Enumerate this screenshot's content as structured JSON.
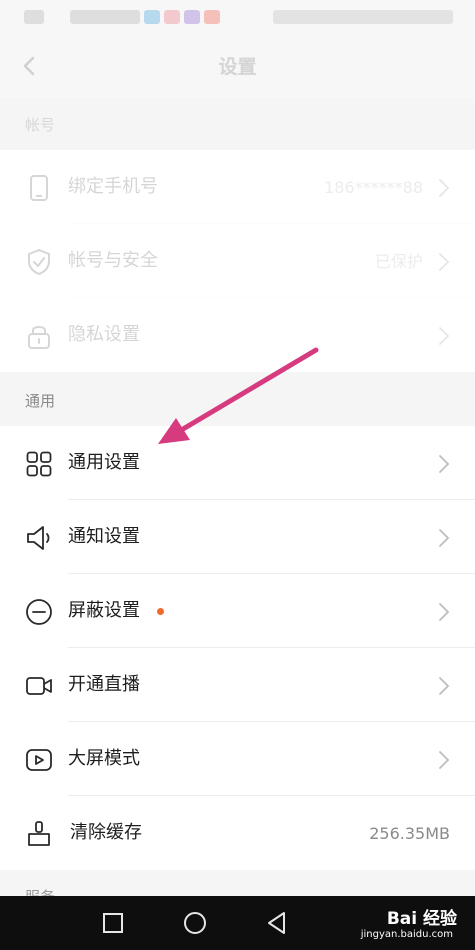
{
  "header": {
    "title": "设置"
  },
  "sections": {
    "account": {
      "title": "帐号",
      "items": [
        {
          "label": "绑定手机号",
          "value": "186******88"
        },
        {
          "label": "帐号与安全",
          "value": "已保护"
        },
        {
          "label": "隐私设置",
          "value": ""
        }
      ]
    },
    "general": {
      "title": "通用",
      "items": [
        {
          "label": "通用设置",
          "value": ""
        },
        {
          "label": "通知设置",
          "value": ""
        },
        {
          "label": "屏蔽设置",
          "value": "",
          "badge": "new-dot"
        },
        {
          "label": "开通直播",
          "value": ""
        },
        {
          "label": "大屏模式",
          "value": ""
        },
        {
          "label": "清除缓存",
          "value": "256.35MB"
        }
      ]
    },
    "service": {
      "title": "服务"
    }
  },
  "watermark": {
    "main": "Bai 经验",
    "sub": "jingyan.baidu.com"
  },
  "colors": {
    "arrow": "#d63a7f",
    "badge": "#f06b2b",
    "nav_background": "#0e0e0e"
  }
}
